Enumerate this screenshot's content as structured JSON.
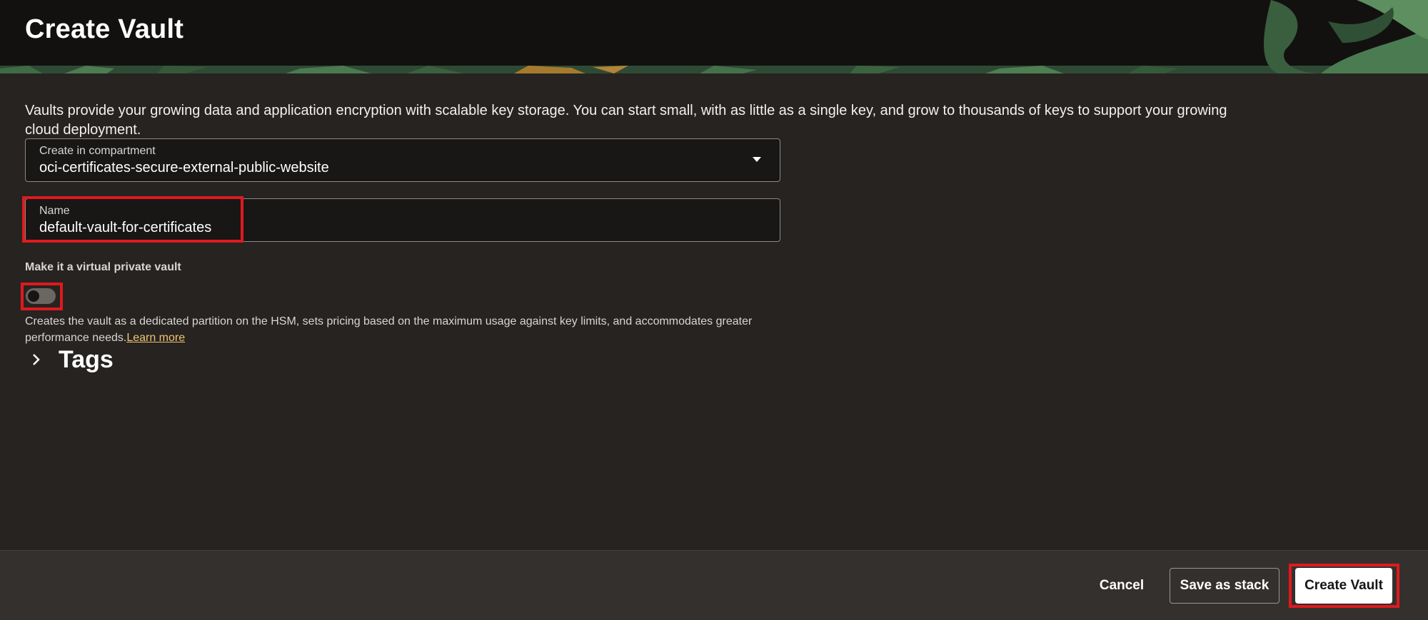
{
  "header": {
    "title": "Create Vault"
  },
  "intro": "Vaults provide your growing data and application encryption with scalable key storage. You can start small, with as little as a single key, and grow to thousands of keys to support your growing cloud deployment.",
  "compartment": {
    "label": "Create in compartment",
    "value": "oci-certificates-secure-external-public-website"
  },
  "name_field": {
    "label": "Name",
    "value": "default-vault-for-certificates"
  },
  "virtual_private_vault": {
    "label": "Make it a virtual private vault",
    "enabled": false,
    "help_text": "Creates the vault as a dedicated partition on the HSM, sets pricing based on the maximum usage against key limits, and accommodates greater performance needs.",
    "learn_more": "Learn more"
  },
  "tags": {
    "title": "Tags"
  },
  "footer": {
    "cancel_label": "Cancel",
    "save_stack_label": "Save as stack",
    "create_label": "Create Vault"
  },
  "colors": {
    "highlight": "#e0191e",
    "link": "#f1c473",
    "header_bg": "#121110",
    "page_bg": "#262321"
  }
}
